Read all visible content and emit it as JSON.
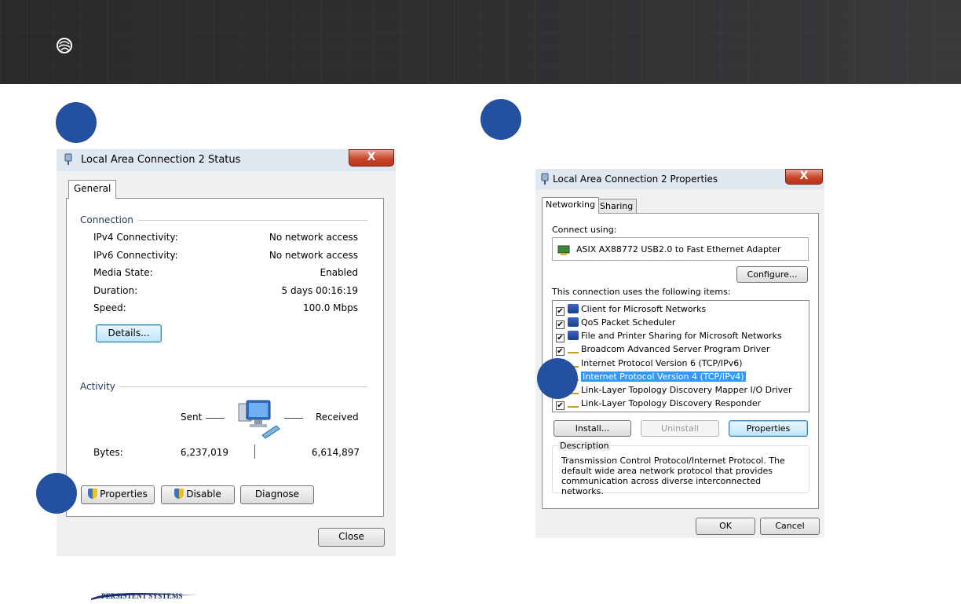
{
  "banner": {
    "logo_icon": "persistent-systems-globe-icon"
  },
  "steps": [
    {
      "color": "#23509f"
    },
    {
      "color": "#23509f"
    },
    {
      "color": "#23509f"
    },
    {
      "color": "#23509f"
    }
  ],
  "status_window": {
    "title": "Local Area Connection 2 Status",
    "close_label": "X",
    "tab": "General",
    "connection_group": "Connection",
    "rows": [
      {
        "label": "IPv4 Connectivity:",
        "value": "No network access"
      },
      {
        "label": "IPv6 Connectivity:",
        "value": "No network access"
      },
      {
        "label": "Media State:",
        "value": "Enabled"
      },
      {
        "label": "Duration:",
        "value": "5 days 00:16:19"
      },
      {
        "label": "Speed:",
        "value": "100.0 Mbps"
      }
    ],
    "details_button": "Details...",
    "activity_group": "Activity",
    "sent_label": "Sent",
    "received_label": "Received",
    "bytes_label": "Bytes:",
    "bytes_sent": "6,237,019",
    "bytes_received": "6,614,897",
    "properties_button": "Properties",
    "disable_button": "Disable",
    "diagnose_button": "Diagnose",
    "close_button": "Close"
  },
  "properties_window": {
    "title": "Local Area Connection 2 Properties",
    "close_label": "X",
    "tabs": [
      "Networking",
      "Sharing"
    ],
    "connect_using_label": "Connect using:",
    "adapter_name": "ASIX AX88772 USB2.0 to Fast Ethernet Adapter",
    "configure_button": "Configure...",
    "items_label": "This connection uses the following items:",
    "items": [
      {
        "label": "Client for Microsoft Networks",
        "checked": "✔",
        "icon": "network-client-icon"
      },
      {
        "label": "QoS Packet Scheduler",
        "checked": "✔",
        "icon": "network-service-icon"
      },
      {
        "label": "File and Printer Sharing for Microsoft Networks",
        "checked": "✔",
        "icon": "network-service-icon"
      },
      {
        "label": "Broadcom Advanced Server Program Driver",
        "checked": "✔",
        "icon": "protocol-icon"
      },
      {
        "label": "Internet Protocol Version 6 (TCP/IPv6)",
        "checked": "",
        "icon": "protocol-icon"
      },
      {
        "label": "Internet Protocol Version 4 (TCP/IPv4)",
        "checked": "",
        "icon": "protocol-icon"
      },
      {
        "label": "Link-Layer Topology Discovery Mapper I/O Driver",
        "checked": "",
        "icon": "protocol-icon"
      },
      {
        "label": "Link-Layer Topology Discovery Responder",
        "checked": "✔",
        "icon": "protocol-icon"
      }
    ],
    "install_button": "Install...",
    "uninstall_button": "Uninstall",
    "properties_button": "Properties",
    "description_label": "Description",
    "description_text": "Transmission Control Protocol/Internet Protocol. The default wide area network protocol that provides communication across diverse interconnected networks.",
    "ok_button": "OK",
    "cancel_button": "Cancel"
  },
  "footer": {
    "logo_text": "PERSISTENT SYSTEMS"
  }
}
